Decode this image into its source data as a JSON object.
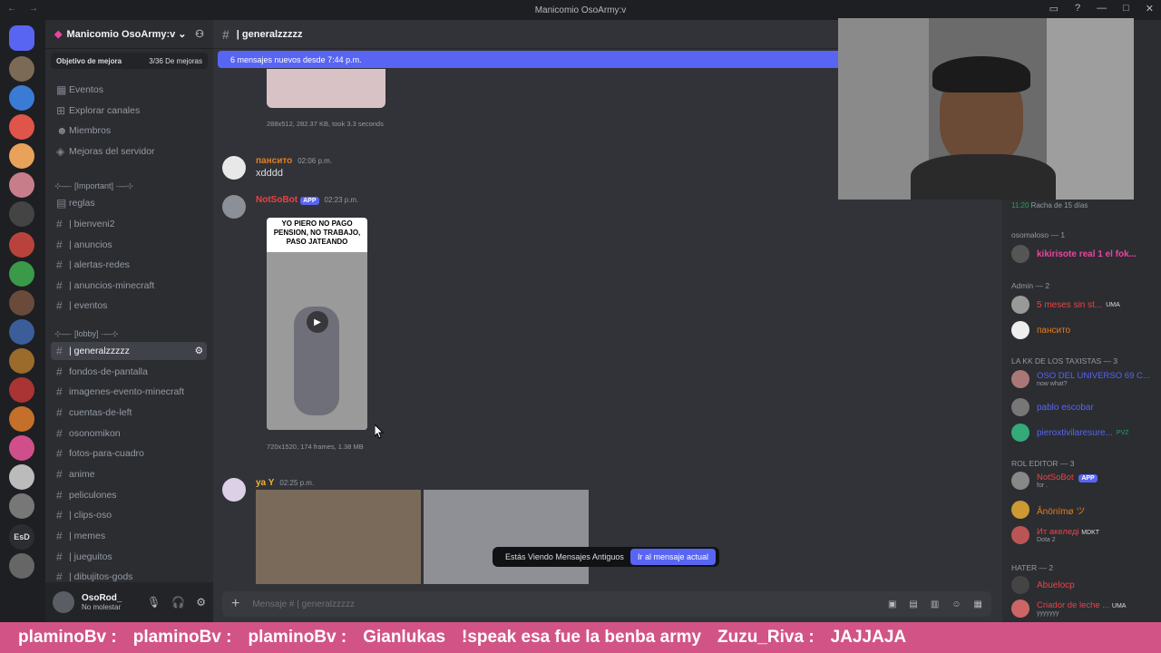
{
  "window": {
    "title": "Manicomio OsoArmy:v"
  },
  "server": {
    "name": "Manicomio OsoArmy:v",
    "goal_label": "Objetivo de mejora",
    "goal_progress": "3/36 De mejoras",
    "goal_fraction": 0.083
  },
  "nav": [
    {
      "label": "Eventos"
    },
    {
      "label": "Explorar canales"
    },
    {
      "label": "Miembros"
    },
    {
      "label": "Mejoras del servidor"
    }
  ],
  "categories": {
    "important": "⊹—· [Important] ·—⊹",
    "lobby": "⊹—· [lobby] ·—⊹"
  },
  "channels_important": [
    "reglas",
    "| bienveni2",
    "| anuncios",
    "| alertas-redes",
    "| anuncios-minecraft",
    "| eventos"
  ],
  "channels_lobby": [
    "| generalzzzzz",
    "fondos-de-pantalla",
    "imagenes-evento-minecraft",
    "cuentas-de-left",
    "osonomikon",
    "fotos-para-cuadro",
    "anime",
    "peliculones",
    "| clips-oso",
    "| memes",
    "| jueguitos",
    "| dibujitos-gods"
  ],
  "user": {
    "name": "OsoRod_",
    "status": "No molestar"
  },
  "channel": {
    "name": "| generalzzzzz",
    "new_messages": "6 mensajes nuevos desde 7:44 p.m.",
    "composer_placeholder": "Mensaje # | generalzzzzz"
  },
  "messages": {
    "m0": {
      "meta": "288x512, 282.37 KB, took 3.3 seconds"
    },
    "m1": {
      "author": "пансито",
      "time": "02:06 p.m.",
      "text": "xdddd",
      "color": "#e67e22"
    },
    "m2": {
      "author": "NotSoBot",
      "badge": "APP",
      "time": "02:23 p.m.",
      "meme_caption": "YO PIERO NO PAGO PENSION, NO TRABAJO, PASO JATEANDO",
      "meta": "720x1520, 174 frames, 1.38 MB",
      "color": "#ed4245"
    },
    "m3": {
      "author": "ya Y",
      "time": "02:25 p.m.",
      "color": "#f0b232"
    }
  },
  "jump": {
    "text": "Estás Viendo Mensajes Antiguos",
    "button": "Ir al mensaje actual"
  },
  "members": {
    "streak": "Racha de 15 días",
    "time": "11:20",
    "cats": [
      "osomaloso — 1",
      "Admin — 2",
      "LA KK DE LOS TAXISTAS — 3",
      "ROL EDITOR — 3",
      "HATER — 2"
    ],
    "list": [
      {
        "name": "kikirisote real 1 el fok...",
        "color": "#eb459e"
      },
      {
        "name": "5 meses sin st...",
        "color": "#ed4245",
        "tag": "UMA"
      },
      {
        "name": "пансито",
        "color": "#e67e22"
      },
      {
        "name": "OSO DEL UNIVERSO 69 C...",
        "sub": "now what?",
        "color": "#3ba55d"
      },
      {
        "name": "pablo escobar",
        "color": "#3ba55d"
      },
      {
        "name": "pieroxtivilaresure...",
        "color": "#3ba55d",
        "tag": "PVZ"
      },
      {
        "name": "NotSoBot",
        "color": "#ed4245",
        "tag": "APP",
        "sub": "for ."
      },
      {
        "name": "Ânönïmø ツ",
        "color": "#e67e22"
      },
      {
        "name": "Ит акеледі",
        "color": "#ed4245",
        "tag": "MDKT",
        "sub": "Dota 2"
      },
      {
        "name": "Abuelocp",
        "color": "#ed4245"
      },
      {
        "name": "Criador de leche ...",
        "color": "#ed4245",
        "tag": "UMA",
        "sub": "yyyyyyy"
      }
    ]
  },
  "ticker": [
    "plaminoBv :",
    "plaminoBv :",
    "plaminoBv :",
    "Gianlukas",
    "!speak esa fue la benba army",
    "Zuzu_Riva :",
    "JAJJAJA"
  ]
}
